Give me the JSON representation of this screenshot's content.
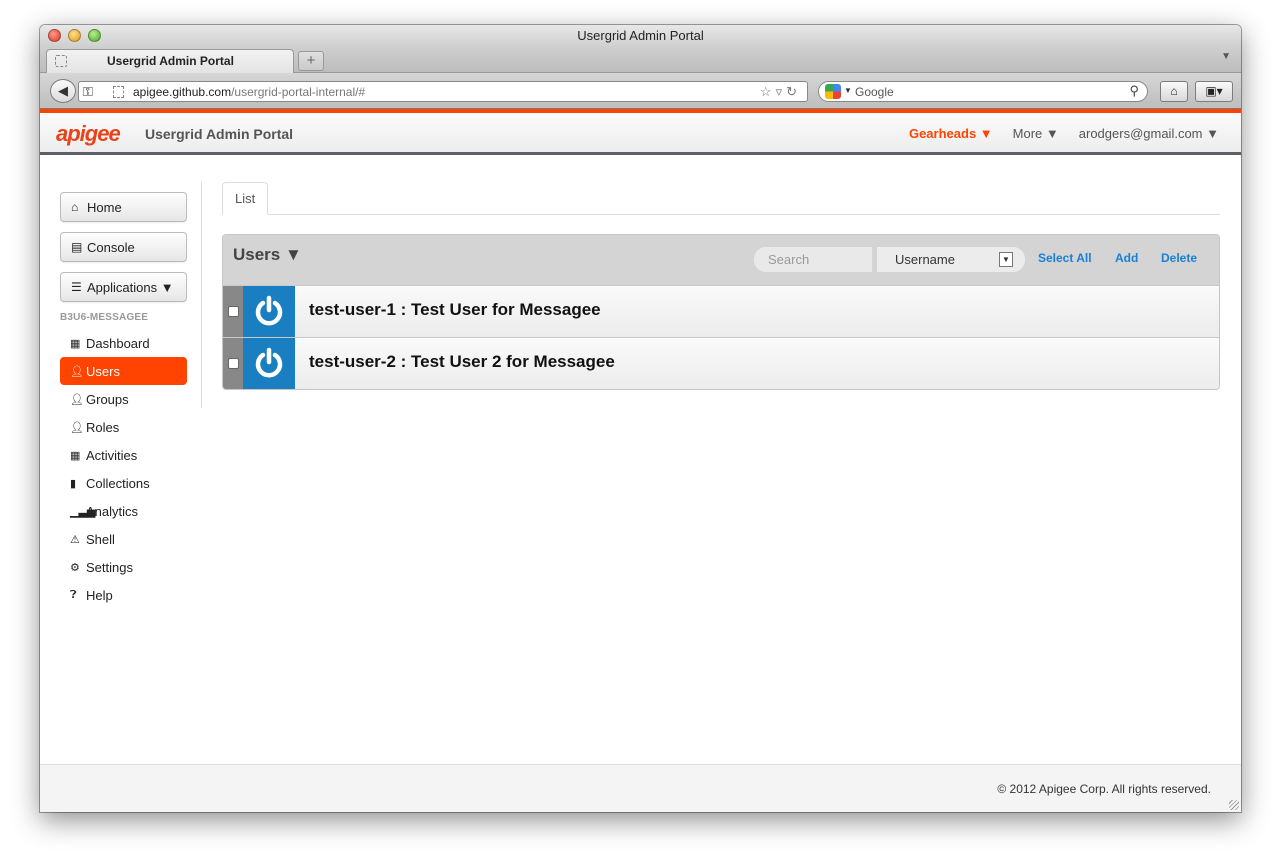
{
  "browser": {
    "window_title": "Usergrid Admin Portal",
    "tab_title": "Usergrid Admin Portal",
    "new_tab_label": "+",
    "url_host": "apigee.github.com",
    "url_path": "/usergrid-portal-internal/#",
    "search_placeholder": "Google"
  },
  "header": {
    "logo_text": "apigee",
    "app_title": "Usergrid Admin Portal",
    "org_menu": "Gearheads ▼",
    "more_menu": "More ▼",
    "account_menu": "arodgers@gmail.com ▼",
    "accent_color": "#ff4300"
  },
  "sidebar": {
    "buttons": [
      {
        "label": "Home",
        "icon": "home-icon"
      },
      {
        "label": "Console",
        "icon": "list-icon"
      },
      {
        "label": "Applications ▼",
        "icon": "menu-list-icon"
      }
    ],
    "app_name": "B3U6-MESSAGEE",
    "items": [
      {
        "label": "Dashboard",
        "icon": "grid-icon",
        "active": false
      },
      {
        "label": "Users",
        "icon": "user-icon",
        "active": true
      },
      {
        "label": "Groups",
        "icon": "user-icon",
        "active": false
      },
      {
        "label": "Roles",
        "icon": "user-icon",
        "active": false
      },
      {
        "label": "Activities",
        "icon": "calendar-icon",
        "active": false
      },
      {
        "label": "Collections",
        "icon": "book-icon",
        "active": false
      },
      {
        "label": "Analytics",
        "icon": "bar-chart-icon",
        "active": false
      },
      {
        "label": "Shell",
        "icon": "warning-icon",
        "active": false
      },
      {
        "label": "Settings",
        "icon": "gear-icon",
        "active": false
      },
      {
        "label": "Help",
        "icon": "question-icon",
        "active": false
      }
    ]
  },
  "main": {
    "tabs": [
      {
        "label": "List"
      }
    ],
    "panel": {
      "title": "Users ▼",
      "search_placeholder": "Search",
      "search_field": "Username",
      "select_all": "Select All",
      "add": "Add",
      "delete": "Delete"
    },
    "users": [
      {
        "label": "test-user-1 : Test User for Messagee"
      },
      {
        "label": "test-user-2 : Test User 2 for Messagee"
      }
    ]
  },
  "footer": {
    "copyright": "© 2012 Apigee Corp. All rights reserved."
  }
}
